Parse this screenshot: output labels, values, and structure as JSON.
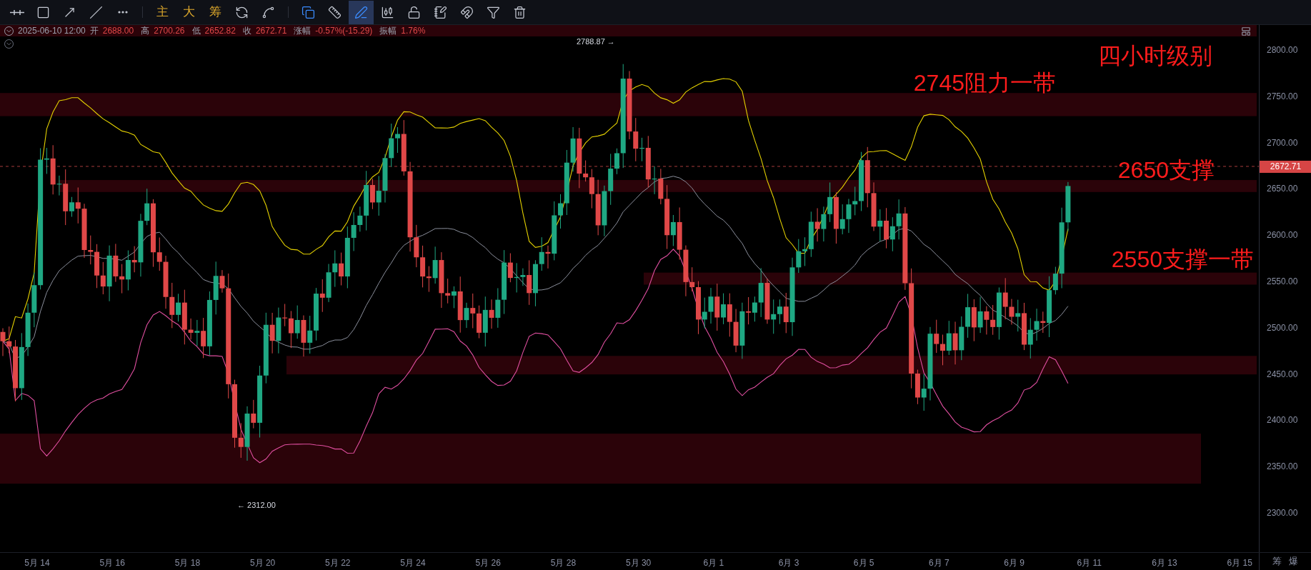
{
  "toolbar": {
    "groups": [
      [
        {
          "kind": "icon",
          "selected": false,
          "on": false
        },
        {
          "kind": "icon",
          "selected": false,
          "on": false
        },
        {
          "kind": "icon",
          "selected": false,
          "on": false
        },
        {
          "kind": "icon",
          "selected": false,
          "on": false
        },
        {
          "kind": "icon",
          "selected": false,
          "on": false
        }
      ],
      [
        {
          "kind": "text",
          "label": "主",
          "selected": false
        },
        {
          "kind": "text",
          "label": "大",
          "selected": false
        },
        {
          "kind": "text",
          "label": "筹",
          "selected": false
        },
        {
          "kind": "icon",
          "selected": false,
          "on": false
        },
        {
          "kind": "icon",
          "selected": false,
          "on": false
        }
      ],
      [
        {
          "kind": "icon",
          "selected": false,
          "on": true
        },
        {
          "kind": "icon",
          "selected": false,
          "on": false
        },
        {
          "kind": "icon",
          "selected": true
        },
        {
          "kind": "icon",
          "selected": false,
          "on": false
        },
        {
          "kind": "icon",
          "selected": false,
          "on": false
        },
        {
          "kind": "icon",
          "selected": false,
          "on": false
        },
        {
          "kind": "icon",
          "selected": false,
          "on": false
        },
        {
          "kind": "icon",
          "selected": false,
          "on": false
        },
        {
          "kind": "icon",
          "selected": false,
          "on": false
        }
      ]
    ]
  },
  "info_bar": {
    "datetime": "2025-06-10 12:00",
    "fields": [
      {
        "label": "开",
        "value": "2688.00"
      },
      {
        "label": "高",
        "value": "2700.26"
      },
      {
        "label": "低",
        "value": "2652.82"
      },
      {
        "label": "收",
        "value": "2672.71"
      },
      {
        "label": "涨幅",
        "value": "-0.57%(-15.29)"
      },
      {
        "label": "振幅",
        "value": "1.76%"
      }
    ]
  },
  "chart": {
    "high_label": "2788.87 →",
    "low_label": "← 2312.00",
    "current_price": "2672.71",
    "annotations": [
      {
        "text": "四小时级别"
      },
      {
        "text": "2745阻力一带"
      },
      {
        "text": "2650支撑"
      },
      {
        "text": "2550支撑一带"
      }
    ]
  },
  "y_axis": {
    "ticks": [
      "2800.00",
      "2750.00",
      "2700.00",
      "2650.00",
      "2600.00",
      "2550.00",
      "2500.00",
      "2450.00",
      "2400.00",
      "2350.00",
      "2300.00"
    ]
  },
  "x_axis": {
    "labels": [
      "5月 14",
      "5月 16",
      "5月 18",
      "5月 20",
      "5月 22",
      "5月 24",
      "5月 26",
      "5月 28",
      "5月 30",
      "6月 1",
      "6月 3",
      "6月 5",
      "6月 7",
      "6月 9",
      "6月 11",
      "6月 13",
      "6月 15"
    ],
    "corner": [
      "筹",
      "爆"
    ]
  }
}
